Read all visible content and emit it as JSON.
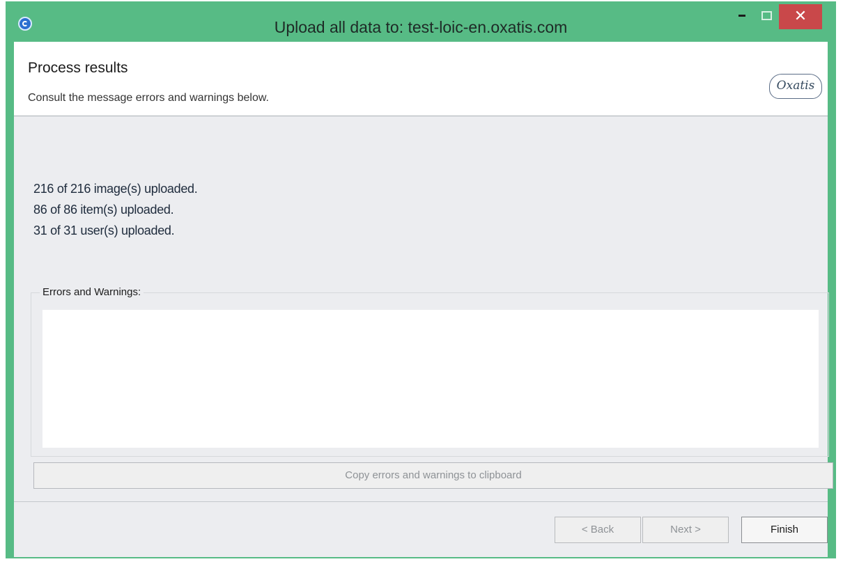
{
  "window": {
    "title": "Upload all data to: test-loic-en.oxatis.com",
    "close_glyph": "✕",
    "colors": {
      "frame": "#57bb85",
      "close": "#c9484a"
    }
  },
  "header": {
    "title": "Process results",
    "subtitle": "Consult the message errors and warnings below.",
    "logo_text": "Oxatis"
  },
  "results": {
    "lines": [
      "216 of 216 image(s) uploaded.",
      "86 of 86 item(s) uploaded.",
      "31 of 31 user(s) uploaded."
    ]
  },
  "errors": {
    "label": "Errors and Warnings:",
    "content": ""
  },
  "buttons": {
    "copy": "Copy errors and warnings to clipboard",
    "back": "< Back",
    "next": "Next >",
    "finish": "Finish"
  }
}
